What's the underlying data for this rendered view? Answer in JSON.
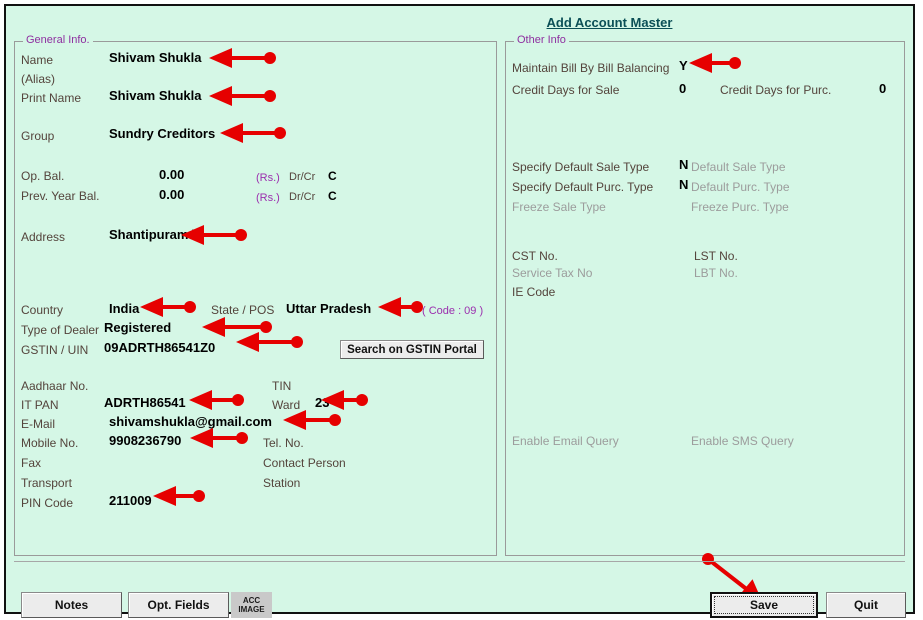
{
  "window": {
    "title": "Add Account Master",
    "background_color": "#d5f7e6",
    "accent_color": "#8e2fa0",
    "title_color": "#0b4f56",
    "arrow_color": "#e60000"
  },
  "general_info": {
    "legend": "General Info.",
    "rows": {
      "name": {
        "label": "Name",
        "value": "Shivam Shukla"
      },
      "alias": {
        "label": "(Alias)",
        "value": ""
      },
      "print_name": {
        "label": "Print Name",
        "value": "Shivam Shukla"
      },
      "group": {
        "label": "Group",
        "value": "Sundry Creditors"
      },
      "op_bal": {
        "label": "Op. Bal.",
        "value": "0.00",
        "rs": "(Rs.)",
        "drcr_label": "Dr/Cr",
        "drcr": "C"
      },
      "prev_year_bal": {
        "label": "Prev. Year Bal.",
        "value": "0.00",
        "rs": "(Rs.)",
        "drcr_label": "Dr/Cr",
        "drcr": "C"
      },
      "address": {
        "label": "Address",
        "value": "Shantipuram \\"
      },
      "country": {
        "label": "Country",
        "value": "India"
      },
      "state_pos": {
        "label": "State / POS",
        "value": "Uttar Pradesh",
        "code": "( Code : 09 )"
      },
      "type_of_dealer": {
        "label": "Type of Dealer",
        "value": "Registered"
      },
      "gstin_uin": {
        "label": "GSTIN / UIN",
        "value": "09ADRTH86541Z0"
      },
      "aadhaar_no": {
        "label": "Aadhaar No.",
        "value": ""
      },
      "tin": {
        "label": "TIN",
        "value": ""
      },
      "it_pan": {
        "label": "IT PAN",
        "value": "ADRTH86541"
      },
      "ward": {
        "label": "Ward",
        "value": "23"
      },
      "email": {
        "label": "E-Mail",
        "value": "shivamshukla@gmail.com"
      },
      "mobile_no": {
        "label": "Mobile No.",
        "value": "9908236790"
      },
      "tel_no": {
        "label": "Tel. No.",
        "value": ""
      },
      "fax": {
        "label": "Fax",
        "value": ""
      },
      "contact_person": {
        "label": "Contact Person",
        "value": ""
      },
      "transport": {
        "label": "Transport",
        "value": ""
      },
      "station": {
        "label": "Station",
        "value": ""
      },
      "pin_code": {
        "label": "PIN Code",
        "value": "211009"
      }
    },
    "search_gstin_button": "Search on GSTIN Portal"
  },
  "other_info": {
    "legend": "Other Info",
    "rows": {
      "maintain_bill": {
        "label": "Maintain Bill By Bill Balancing",
        "value": "Y"
      },
      "credit_days_sale": {
        "label": "Credit Days for Sale",
        "value": "0"
      },
      "credit_days_purc": {
        "label": "Credit Days for Purc.",
        "value": "0"
      },
      "specify_sale_type": {
        "label": "Specify Default Sale Type",
        "value": "N"
      },
      "default_sale_type": {
        "label": "Default Sale Type",
        "value": ""
      },
      "specify_purc_type": {
        "label": "Specify Default Purc. Type",
        "value": "N"
      },
      "default_purc_type": {
        "label": "Default Purc. Type",
        "value": ""
      },
      "freeze_sale_type": {
        "label": "Freeze Sale Type",
        "value": ""
      },
      "freeze_purc_type": {
        "label": "Freeze Purc. Type",
        "value": ""
      },
      "cst_no": {
        "label": "CST No.",
        "value": ""
      },
      "lst_no": {
        "label": "LST No.",
        "value": ""
      },
      "service_tax_no": {
        "label": "Service Tax No",
        "value": ""
      },
      "lbt_no": {
        "label": "LBT No.",
        "value": ""
      },
      "ie_code": {
        "label": "IE Code",
        "value": ""
      },
      "enable_email_query": {
        "label": "Enable Email Query",
        "value": ""
      },
      "enable_sms_query": {
        "label": "Enable SMS Query",
        "value": ""
      }
    }
  },
  "footer": {
    "notes_label": "Notes",
    "opt_fields_label": "Opt. Fields",
    "acc_image_line1": "ACC",
    "acc_image_line2": "IMAGE",
    "save_label": "Save",
    "quit_label": "Quit"
  }
}
